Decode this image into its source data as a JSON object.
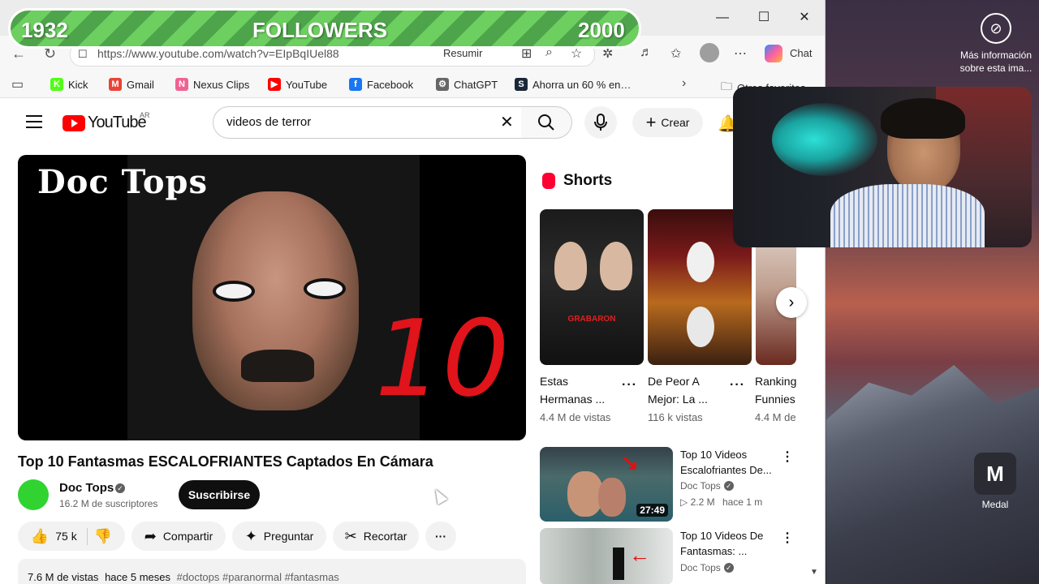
{
  "overlay": {
    "current": "1932",
    "label": "FOLLOWERS",
    "goal": "2000"
  },
  "browser": {
    "url": "https://www.youtube.com/watch?v=EIpBqIUel88",
    "resume_label": "Resumir",
    "chat_label": "Chat",
    "bookmarks": [
      {
        "label": "Kick",
        "icon": "kick-icon",
        "color": "#53fc18",
        "glyph": "K"
      },
      {
        "label": "Gmail",
        "icon": "gmail-icon",
        "color": "#ea4335",
        "glyph": "M"
      },
      {
        "label": "Nexus Clips",
        "icon": "nexus-clips-icon",
        "color": "#f06292",
        "glyph": "N"
      },
      {
        "label": "YouTube",
        "icon": "youtube-icon",
        "color": "#ff0000",
        "glyph": "▶"
      },
      {
        "label": "Facebook",
        "icon": "facebook-icon",
        "color": "#1877f2",
        "glyph": "f"
      },
      {
        "label": "ChatGPT",
        "icon": "chatgpt-icon",
        "color": "#666666",
        "glyph": "⚙"
      },
      {
        "label": "Ahorra un 60 % en…",
        "icon": "steam-icon",
        "color": "#1b2838",
        "glyph": "S"
      }
    ],
    "other_favorites": "Otros favoritos"
  },
  "youtube": {
    "logo_text": "YouTube",
    "region": "AR",
    "search_value": "videos de terror",
    "create_label": "Crear",
    "video": {
      "title": "Top 10 Fantasmas ESCALOFRIANTES Captados En Cámara",
      "thumb_text": "Doc Tops",
      "thumb_number": "10",
      "channel": "Doc Tops",
      "subscribers": "16.2 M de suscriptores",
      "subscribe_label": "Suscribirse",
      "likes": "75 k",
      "share_label": "Compartir",
      "ask_label": "Preguntar",
      "clip_label": "Recortar",
      "views": "7.6 M de vistas",
      "age": "hace 5 meses",
      "tags": "#doctops #paranormal #fantasmas"
    },
    "shorts": {
      "heading": "Shorts",
      "items": [
        {
          "title1": "Estas",
          "title2": "Hermanas ...",
          "views": "4.4 M de vistas",
          "overlay": "GRABARON"
        },
        {
          "title1": "De Peor A",
          "title2": "Mejor: La ...",
          "views": "116 k vistas",
          "overlay": ""
        },
        {
          "title1": "Ranking",
          "title2": "Funnies",
          "views": "4.4 M de",
          "overlay": ""
        }
      ]
    },
    "related": [
      {
        "title1": "Top 10 Videos",
        "title2": "Escalofriantes De...",
        "channel": "Doc Tops",
        "views": "2.2 M",
        "age": "hace 1 m",
        "duration": "27:49"
      },
      {
        "title1": "Top 10 Videos De",
        "title2": "Fantasmas: ...",
        "channel": "Doc Tops",
        "views": "",
        "age": "",
        "duration": ""
      }
    ]
  },
  "desktop": {
    "more_info": "Más información sobre esta ima...",
    "medal_label": "Medal"
  }
}
